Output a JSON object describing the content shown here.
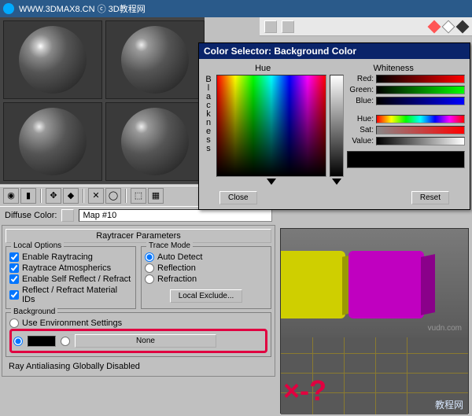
{
  "url_bar": "WWW.3DMAX8.CN ⓒ 3D教程网",
  "material_toolbar": {
    "icons": [
      "sphere-icon",
      "cylinder-icon",
      "cube-icon",
      "teapot-icon",
      "light-icon",
      "backlight-icon",
      "pattern-icon",
      "uv-icon",
      "options-icon",
      "apply-icon"
    ]
  },
  "diffuse": {
    "label": "Diffuse Color:",
    "value": "Map #10"
  },
  "raytracer": {
    "title": "Raytracer Parameters",
    "local_options": {
      "title": "Local Options",
      "enable_raytracing": "Enable Raytracing",
      "raytrace_atmospherics": "Raytrace Atmospherics",
      "enable_self": "Enable Self Reflect / Refract",
      "reflect_refract_ids": "Reflect / Refract Material IDs"
    },
    "trace_mode": {
      "title": "Trace Mode",
      "auto_detect": "Auto Detect",
      "reflection": "Reflection",
      "refraction": "Refraction",
      "local_exclude": "Local Exclude..."
    },
    "background": {
      "title": "Background",
      "use_env": "Use Environment Settings",
      "none_btn": "None"
    },
    "antialias": "Ray Antialiasing Globally Disabled"
  },
  "color_selector": {
    "title": "Color Selector: Background Color",
    "hue_label": "Hue",
    "whiteness_label": "Whiteness",
    "blackness_label": "Blackness",
    "red": "Red:",
    "green": "Green:",
    "blue": "Blue:",
    "hue": "Hue:",
    "sat": "Sat:",
    "value": "Value:",
    "close_btn": "Close",
    "reset_btn": "Reset"
  },
  "viewport": {
    "watermark1": "vudn.com",
    "watermark2": "教程网"
  },
  "scribble": "×-?"
}
